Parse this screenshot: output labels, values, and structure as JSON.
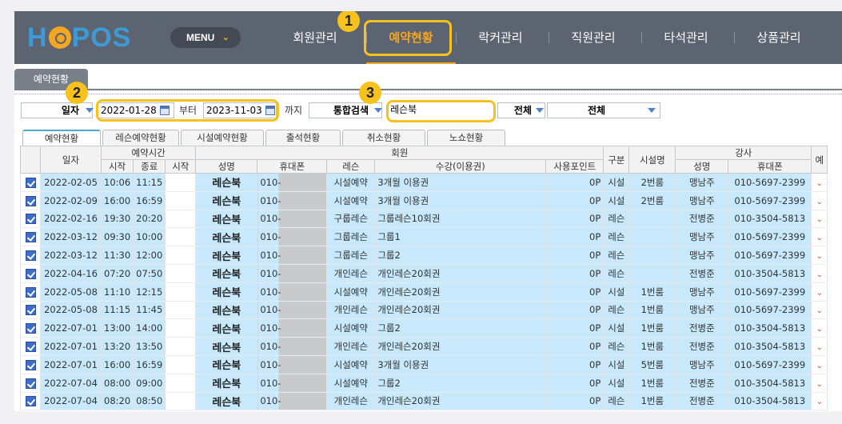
{
  "app": {
    "logo": "HOPOS",
    "logo_pre": "H",
    "logo_post": "POS"
  },
  "nav": {
    "menu_label": "MENU",
    "items": [
      "회원관리",
      "예약현황",
      "락커관리",
      "직원관리",
      "타석관리",
      "상품관리"
    ],
    "active": "예약현황"
  },
  "badges": [
    "1",
    "2",
    "3"
  ],
  "page_tab": "예약현황",
  "search": {
    "date_type": "일자",
    "date_from": "2022-01-28",
    "from_label": "부터",
    "date_to": "2023-11-03",
    "to_label": "까지",
    "search_type": "통합검색",
    "keyword": "레슨북",
    "filter1": "전체",
    "filter2": "전체"
  },
  "subtabs": [
    "예약현황",
    "레슨예약현황",
    "시설예약현황",
    "출석현황",
    "취소현황",
    "노쇼현황"
  ],
  "table": {
    "header_groups": {
      "date": "일자",
      "reservation_time": "예약시간",
      "member": "회원",
      "category": "구분",
      "facility": "시설명",
      "instructor": "강사",
      "extra": "예"
    },
    "sub_headers": [
      "시작",
      "종료",
      "시작",
      "성명",
      "휴대폰",
      "레슨",
      "수강(이용권)",
      "사용포인트",
      "성명",
      "휴대폰"
    ],
    "rows": [
      {
        "date": "2022-02-05",
        "start": "10:06",
        "end": "11:15",
        "name": "레슨북",
        "phone": "010-",
        "lesson": "시설예약",
        "pass": "3개월 이용권",
        "points": "0P",
        "category": "시설",
        "facility": "2번룸",
        "inst_name": "맹남주",
        "inst_phone": "010-5697-2399"
      },
      {
        "date": "2022-02-09",
        "start": "16:00",
        "end": "16:59",
        "name": "레슨북",
        "phone": "010-",
        "lesson": "시설예약",
        "pass": "3개월 이용권",
        "points": "0P",
        "category": "시설",
        "facility": "2번룸",
        "inst_name": "맹남주",
        "inst_phone": "010-5697-2399"
      },
      {
        "date": "2022-02-16",
        "start": "19:30",
        "end": "20:20",
        "name": "레슨북",
        "phone": "010-",
        "lesson": "구룹레슨",
        "pass": "그룹레슨10회권",
        "points": "0P",
        "category": "레슨",
        "facility": "",
        "inst_name": "전병준",
        "inst_phone": "010-3504-5813"
      },
      {
        "date": "2022-03-12",
        "start": "09:30",
        "end": "10:00",
        "name": "레슨북",
        "phone": "010-",
        "lesson": "그룹레슨",
        "pass": "그룹1",
        "points": "0P",
        "category": "레슨",
        "facility": "",
        "inst_name": "맹남주",
        "inst_phone": "010-5697-2399"
      },
      {
        "date": "2022-03-12",
        "start": "11:30",
        "end": "12:00",
        "name": "레슨북",
        "phone": "010-",
        "lesson": "그룹레슨",
        "pass": "그룹2",
        "points": "0P",
        "category": "레슨",
        "facility": "",
        "inst_name": "맹남주",
        "inst_phone": "010-5697-2399"
      },
      {
        "date": "2022-04-16",
        "start": "07:20",
        "end": "07:50",
        "name": "레슨북",
        "phone": "010-",
        "lesson": "개인레슨",
        "pass": "개인레슨20회권",
        "points": "0P",
        "category": "레슨",
        "facility": "",
        "inst_name": "전병준",
        "inst_phone": "010-3504-5813"
      },
      {
        "date": "2022-05-08",
        "start": "11:10",
        "end": "12:15",
        "name": "레슨북",
        "phone": "010-",
        "lesson": "시설예약",
        "pass": "개인레슨20회권",
        "points": "0P",
        "category": "시설",
        "facility": "1번룸",
        "inst_name": "맹남주",
        "inst_phone": "010-5697-2399"
      },
      {
        "date": "2022-05-08",
        "start": "11:15",
        "end": "11:45",
        "name": "레슨북",
        "phone": "010-",
        "lesson": "개인레슨",
        "pass": "개인레슨20회권",
        "points": "0P",
        "category": "레슨",
        "facility": "1번룸",
        "inst_name": "맹남주",
        "inst_phone": "010-5697-2399"
      },
      {
        "date": "2022-07-01",
        "start": "13:00",
        "end": "14:00",
        "name": "레슨북",
        "phone": "010-",
        "lesson": "시설예약",
        "pass": "그룹2",
        "points": "0P",
        "category": "시설",
        "facility": "1번룸",
        "inst_name": "전병준",
        "inst_phone": "010-3504-5813"
      },
      {
        "date": "2022-07-01",
        "start": "13:20",
        "end": "13:50",
        "name": "레슨북",
        "phone": "010-",
        "lesson": "개인레슨",
        "pass": "개인레슨20회권",
        "points": "0P",
        "category": "레슨",
        "facility": "1번룸",
        "inst_name": "전병준",
        "inst_phone": "010-3504-5813"
      },
      {
        "date": "2022-07-01",
        "start": "16:00",
        "end": "16:59",
        "name": "레슨북",
        "phone": "010-",
        "lesson": "시설예약",
        "pass": "3개월 이용권",
        "points": "0P",
        "category": "시설",
        "facility": "5번룸",
        "inst_name": "맹남주",
        "inst_phone": "010-5697-2399"
      },
      {
        "date": "2022-07-04",
        "start": "08:00",
        "end": "09:00",
        "name": "레슨북",
        "phone": "010-",
        "lesson": "시설예약",
        "pass": "그룹2",
        "points": "0P",
        "category": "시설",
        "facility": "1번룸",
        "inst_name": "전병준",
        "inst_phone": "010-3504-5813"
      },
      {
        "date": "2022-07-04",
        "start": "08:20",
        "end": "08:50",
        "name": "레슨북",
        "phone": "010-",
        "lesson": "개인레슨",
        "pass": "개인레슨20회권",
        "points": "0P",
        "category": "레슨",
        "facility": "1번룸",
        "inst_name": "전병준",
        "inst_phone": "010-3504-5813"
      }
    ]
  },
  "colors": {
    "nav_bg": "#5b6470",
    "accent": "#f7c21d",
    "row_bg": "#c8e8fb",
    "logo_blue": "#3d9ad6"
  }
}
